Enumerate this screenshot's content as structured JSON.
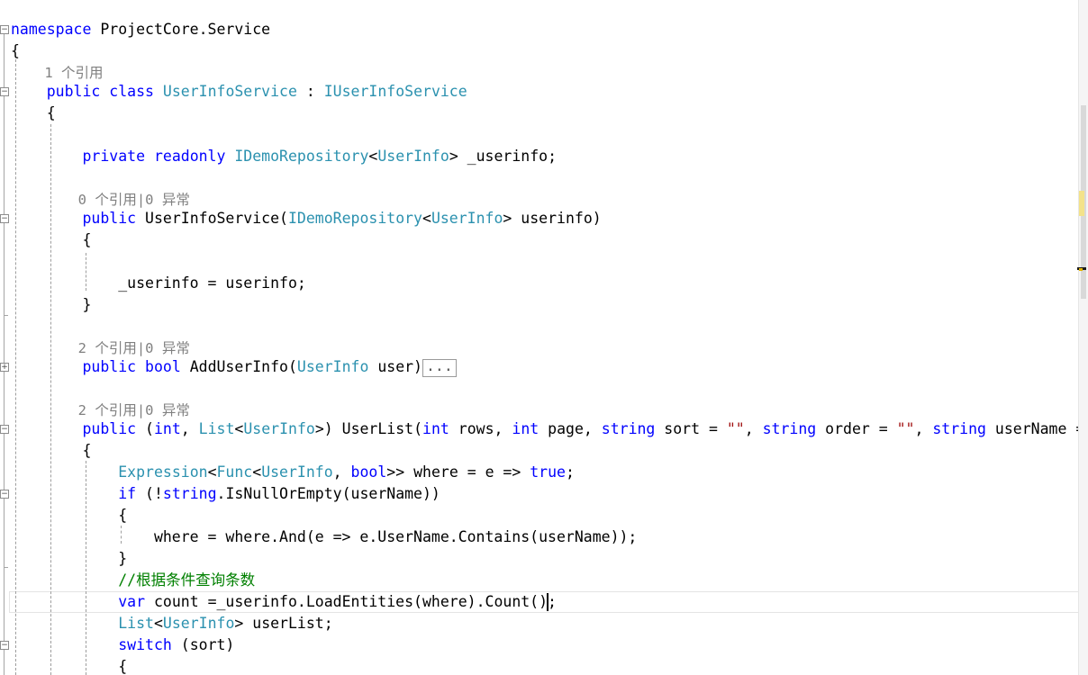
{
  "editor": {
    "lines": [
      {
        "tokens": [
          {
            "t": "namespace",
            "c": "kw"
          },
          {
            "t": " ProjectCore.Service",
            "c": ""
          }
        ]
      },
      {
        "tokens": [
          {
            "t": "{",
            "c": ""
          }
        ]
      },
      {
        "tokens": [
          {
            "t": "    1 个引用",
            "c": "lens"
          }
        ]
      },
      {
        "tokens": [
          {
            "t": "    ",
            "c": ""
          },
          {
            "t": "public class",
            "c": "kw"
          },
          {
            "t": " ",
            "c": ""
          },
          {
            "t": "UserInfoService",
            "c": "ty"
          },
          {
            "t": " : ",
            "c": ""
          },
          {
            "t": "IUserInfoService",
            "c": "ty"
          }
        ]
      },
      {
        "tokens": [
          {
            "t": "    {",
            "c": ""
          }
        ]
      },
      {
        "tokens": []
      },
      {
        "tokens": [
          {
            "t": "        ",
            "c": ""
          },
          {
            "t": "private readonly",
            "c": "kw"
          },
          {
            "t": " ",
            "c": ""
          },
          {
            "t": "IDemoRepository",
            "c": "ty"
          },
          {
            "t": "<",
            "c": ""
          },
          {
            "t": "UserInfo",
            "c": "ty"
          },
          {
            "t": "> _userinfo;",
            "c": ""
          }
        ]
      },
      {
        "tokens": []
      },
      {
        "tokens": [
          {
            "t": "        0 个引用|0 异常",
            "c": "lens"
          }
        ]
      },
      {
        "tokens": [
          {
            "t": "        ",
            "c": ""
          },
          {
            "t": "public",
            "c": "kw"
          },
          {
            "t": " UserInfoService(",
            "c": ""
          },
          {
            "t": "IDemoRepository",
            "c": "ty"
          },
          {
            "t": "<",
            "c": ""
          },
          {
            "t": "UserInfo",
            "c": "ty"
          },
          {
            "t": "> userinfo)",
            "c": ""
          }
        ]
      },
      {
        "tokens": [
          {
            "t": "        {",
            "c": ""
          }
        ]
      },
      {
        "tokens": []
      },
      {
        "tokens": [
          {
            "t": "            _userinfo = userinfo;",
            "c": ""
          }
        ]
      },
      {
        "tokens": [
          {
            "t": "        }",
            "c": ""
          }
        ]
      },
      {
        "tokens": []
      },
      {
        "tokens": [
          {
            "t": "        2 个引用|0 异常",
            "c": "lens"
          }
        ]
      },
      {
        "tokens": [
          {
            "t": "        ",
            "c": ""
          },
          {
            "t": "public bool",
            "c": "kw"
          },
          {
            "t": " AddUserInfo(",
            "c": ""
          },
          {
            "t": "UserInfo",
            "c": "ty"
          },
          {
            "t": " user)",
            "c": ""
          },
          {
            "t": "...",
            "c": "box"
          }
        ]
      },
      {
        "tokens": []
      },
      {
        "tokens": [
          {
            "t": "        2 个引用|0 异常",
            "c": "lens"
          }
        ]
      },
      {
        "tokens": [
          {
            "t": "        ",
            "c": ""
          },
          {
            "t": "public",
            "c": "kw"
          },
          {
            "t": " (",
            "c": ""
          },
          {
            "t": "int",
            "c": "kw"
          },
          {
            "t": ", ",
            "c": ""
          },
          {
            "t": "List",
            "c": "ty"
          },
          {
            "t": "<",
            "c": ""
          },
          {
            "t": "UserInfo",
            "c": "ty"
          },
          {
            "t": ">) UserList(",
            "c": ""
          },
          {
            "t": "int",
            "c": "kw"
          },
          {
            "t": " rows, ",
            "c": ""
          },
          {
            "t": "int",
            "c": "kw"
          },
          {
            "t": " page, ",
            "c": ""
          },
          {
            "t": "string",
            "c": "kw"
          },
          {
            "t": " sort = ",
            "c": ""
          },
          {
            "t": "\"\"",
            "c": "st"
          },
          {
            "t": ", ",
            "c": ""
          },
          {
            "t": "string",
            "c": "kw"
          },
          {
            "t": " order = ",
            "c": ""
          },
          {
            "t": "\"\"",
            "c": "st"
          },
          {
            "t": ", ",
            "c": ""
          },
          {
            "t": "string",
            "c": "kw"
          },
          {
            "t": " userName = ",
            "c": ""
          },
          {
            "t": "\"",
            "c": "st"
          }
        ]
      },
      {
        "tokens": [
          {
            "t": "        {",
            "c": ""
          }
        ]
      },
      {
        "tokens": [
          {
            "t": "            ",
            "c": ""
          },
          {
            "t": "Expression",
            "c": "ty"
          },
          {
            "t": "<",
            "c": ""
          },
          {
            "t": "Func",
            "c": "ty"
          },
          {
            "t": "<",
            "c": ""
          },
          {
            "t": "UserInfo",
            "c": "ty"
          },
          {
            "t": ", ",
            "c": ""
          },
          {
            "t": "bool",
            "c": "kw"
          },
          {
            "t": ">> where = e => ",
            "c": ""
          },
          {
            "t": "true",
            "c": "kw"
          },
          {
            "t": ";",
            "c": ""
          }
        ]
      },
      {
        "tokens": [
          {
            "t": "            ",
            "c": ""
          },
          {
            "t": "if",
            "c": "kw"
          },
          {
            "t": " (!",
            "c": ""
          },
          {
            "t": "string",
            "c": "kw"
          },
          {
            "t": ".IsNullOrEmpty(userName))",
            "c": ""
          }
        ]
      },
      {
        "tokens": [
          {
            "t": "            {",
            "c": ""
          }
        ]
      },
      {
        "tokens": [
          {
            "t": "                where = where.And(e => e.UserName.Contains(userName));",
            "c": ""
          }
        ]
      },
      {
        "tokens": [
          {
            "t": "            }",
            "c": ""
          }
        ]
      },
      {
        "tokens": [
          {
            "t": "            ",
            "c": ""
          },
          {
            "t": "//根据条件查询条数",
            "c": "cm"
          }
        ]
      },
      {
        "tokens": [
          {
            "t": "            ",
            "c": ""
          },
          {
            "t": "var",
            "c": "kw"
          },
          {
            "t": " count =_userinfo.LoadEntities(where).Count();",
            "c": ""
          }
        ]
      },
      {
        "tokens": [
          {
            "t": "            ",
            "c": ""
          },
          {
            "t": "List",
            "c": "ty"
          },
          {
            "t": "<",
            "c": ""
          },
          {
            "t": "UserInfo",
            "c": "ty"
          },
          {
            "t": "> userList;",
            "c": ""
          }
        ]
      },
      {
        "tokens": [
          {
            "t": "            ",
            "c": ""
          },
          {
            "t": "switch",
            "c": "kw"
          },
          {
            "t": " (sort)",
            "c": ""
          }
        ]
      },
      {
        "tokens": [
          {
            "t": "            {",
            "c": ""
          }
        ]
      }
    ],
    "fold_markers": [
      {
        "symbol": "−",
        "state": "expanded"
      },
      {
        "symbol": "−",
        "state": "expanded"
      },
      {
        "symbol": "−",
        "state": "expanded"
      },
      {
        "symbol": "+",
        "state": "collapsed"
      },
      {
        "symbol": "−",
        "state": "expanded"
      },
      {
        "symbol": "−",
        "state": "expanded"
      },
      {
        "symbol": "−",
        "state": "expanded"
      }
    ]
  },
  "colors": {
    "keyword": "#0000ff",
    "type": "#2b91af",
    "string": "#a31515",
    "comment": "#008000",
    "codelens": "#808080",
    "text": "#000000"
  }
}
